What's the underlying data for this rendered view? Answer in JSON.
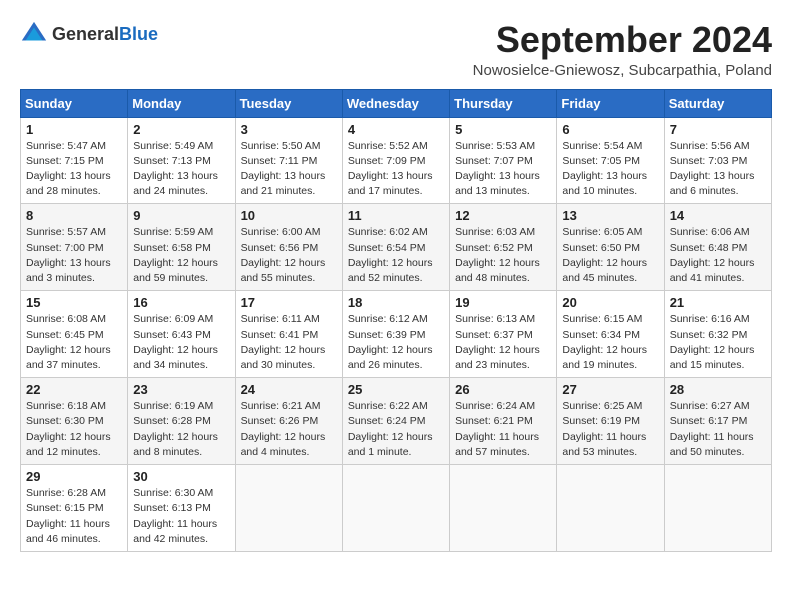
{
  "header": {
    "logo_general": "General",
    "logo_blue": "Blue",
    "month_year": "September 2024",
    "location": "Nowosielce-Gniewosz, Subcarpathia, Poland"
  },
  "weekdays": [
    "Sunday",
    "Monday",
    "Tuesday",
    "Wednesday",
    "Thursday",
    "Friday",
    "Saturday"
  ],
  "weeks": [
    [
      {
        "day": "1",
        "info": "Sunrise: 5:47 AM\nSunset: 7:15 PM\nDaylight: 13 hours and 28 minutes."
      },
      {
        "day": "2",
        "info": "Sunrise: 5:49 AM\nSunset: 7:13 PM\nDaylight: 13 hours and 24 minutes."
      },
      {
        "day": "3",
        "info": "Sunrise: 5:50 AM\nSunset: 7:11 PM\nDaylight: 13 hours and 21 minutes."
      },
      {
        "day": "4",
        "info": "Sunrise: 5:52 AM\nSunset: 7:09 PM\nDaylight: 13 hours and 17 minutes."
      },
      {
        "day": "5",
        "info": "Sunrise: 5:53 AM\nSunset: 7:07 PM\nDaylight: 13 hours and 13 minutes."
      },
      {
        "day": "6",
        "info": "Sunrise: 5:54 AM\nSunset: 7:05 PM\nDaylight: 13 hours and 10 minutes."
      },
      {
        "day": "7",
        "info": "Sunrise: 5:56 AM\nSunset: 7:03 PM\nDaylight: 13 hours and 6 minutes."
      }
    ],
    [
      {
        "day": "8",
        "info": "Sunrise: 5:57 AM\nSunset: 7:00 PM\nDaylight: 13 hours and 3 minutes."
      },
      {
        "day": "9",
        "info": "Sunrise: 5:59 AM\nSunset: 6:58 PM\nDaylight: 12 hours and 59 minutes."
      },
      {
        "day": "10",
        "info": "Sunrise: 6:00 AM\nSunset: 6:56 PM\nDaylight: 12 hours and 55 minutes."
      },
      {
        "day": "11",
        "info": "Sunrise: 6:02 AM\nSunset: 6:54 PM\nDaylight: 12 hours and 52 minutes."
      },
      {
        "day": "12",
        "info": "Sunrise: 6:03 AM\nSunset: 6:52 PM\nDaylight: 12 hours and 48 minutes."
      },
      {
        "day": "13",
        "info": "Sunrise: 6:05 AM\nSunset: 6:50 PM\nDaylight: 12 hours and 45 minutes."
      },
      {
        "day": "14",
        "info": "Sunrise: 6:06 AM\nSunset: 6:48 PM\nDaylight: 12 hours and 41 minutes."
      }
    ],
    [
      {
        "day": "15",
        "info": "Sunrise: 6:08 AM\nSunset: 6:45 PM\nDaylight: 12 hours and 37 minutes."
      },
      {
        "day": "16",
        "info": "Sunrise: 6:09 AM\nSunset: 6:43 PM\nDaylight: 12 hours and 34 minutes."
      },
      {
        "day": "17",
        "info": "Sunrise: 6:11 AM\nSunset: 6:41 PM\nDaylight: 12 hours and 30 minutes."
      },
      {
        "day": "18",
        "info": "Sunrise: 6:12 AM\nSunset: 6:39 PM\nDaylight: 12 hours and 26 minutes."
      },
      {
        "day": "19",
        "info": "Sunrise: 6:13 AM\nSunset: 6:37 PM\nDaylight: 12 hours and 23 minutes."
      },
      {
        "day": "20",
        "info": "Sunrise: 6:15 AM\nSunset: 6:34 PM\nDaylight: 12 hours and 19 minutes."
      },
      {
        "day": "21",
        "info": "Sunrise: 6:16 AM\nSunset: 6:32 PM\nDaylight: 12 hours and 15 minutes."
      }
    ],
    [
      {
        "day": "22",
        "info": "Sunrise: 6:18 AM\nSunset: 6:30 PM\nDaylight: 12 hours and 12 minutes."
      },
      {
        "day": "23",
        "info": "Sunrise: 6:19 AM\nSunset: 6:28 PM\nDaylight: 12 hours and 8 minutes."
      },
      {
        "day": "24",
        "info": "Sunrise: 6:21 AM\nSunset: 6:26 PM\nDaylight: 12 hours and 4 minutes."
      },
      {
        "day": "25",
        "info": "Sunrise: 6:22 AM\nSunset: 6:24 PM\nDaylight: 12 hours and 1 minute."
      },
      {
        "day": "26",
        "info": "Sunrise: 6:24 AM\nSunset: 6:21 PM\nDaylight: 11 hours and 57 minutes."
      },
      {
        "day": "27",
        "info": "Sunrise: 6:25 AM\nSunset: 6:19 PM\nDaylight: 11 hours and 53 minutes."
      },
      {
        "day": "28",
        "info": "Sunrise: 6:27 AM\nSunset: 6:17 PM\nDaylight: 11 hours and 50 minutes."
      }
    ],
    [
      {
        "day": "29",
        "info": "Sunrise: 6:28 AM\nSunset: 6:15 PM\nDaylight: 11 hours and 46 minutes."
      },
      {
        "day": "30",
        "info": "Sunrise: 6:30 AM\nSunset: 6:13 PM\nDaylight: 11 hours and 42 minutes."
      },
      null,
      null,
      null,
      null,
      null
    ]
  ]
}
